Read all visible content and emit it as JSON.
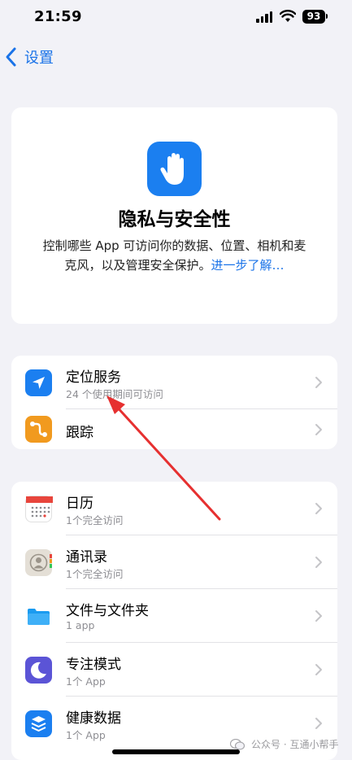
{
  "status_bar": {
    "time": "21:59",
    "battery": "93"
  },
  "nav": {
    "back_label": "设置"
  },
  "hero": {
    "title": "隐私与安全性",
    "description": "控制哪些 App 可访问你的数据、位置、相机和麦克风，以及管理安全保护。",
    "link": "进一步了解…"
  },
  "group1": [
    {
      "label": "定位服务",
      "sub": "24 个使用期间可访问",
      "icon": "location-icon",
      "color": "#1b7ff0"
    },
    {
      "label": "跟踪",
      "icon": "tracking-icon",
      "color": "#f19a1f"
    }
  ],
  "group2": [
    {
      "label": "日历",
      "sub": "1个完全访问",
      "icon": "calendar-icon"
    },
    {
      "label": "通讯录",
      "sub": "1个完全访问",
      "icon": "contacts-icon"
    },
    {
      "label": "文件与文件夹",
      "sub": "1 app",
      "icon": "folder-icon"
    },
    {
      "label": "专注模式",
      "sub": "1个 App",
      "icon": "focus-moon-icon",
      "color": "#5b54d6"
    },
    {
      "label": "健康数据",
      "sub": "1个 App",
      "icon": "health-data-icon",
      "color": "#1b7ff0"
    }
  ],
  "watermark": "公众号 · 互通小帮手"
}
